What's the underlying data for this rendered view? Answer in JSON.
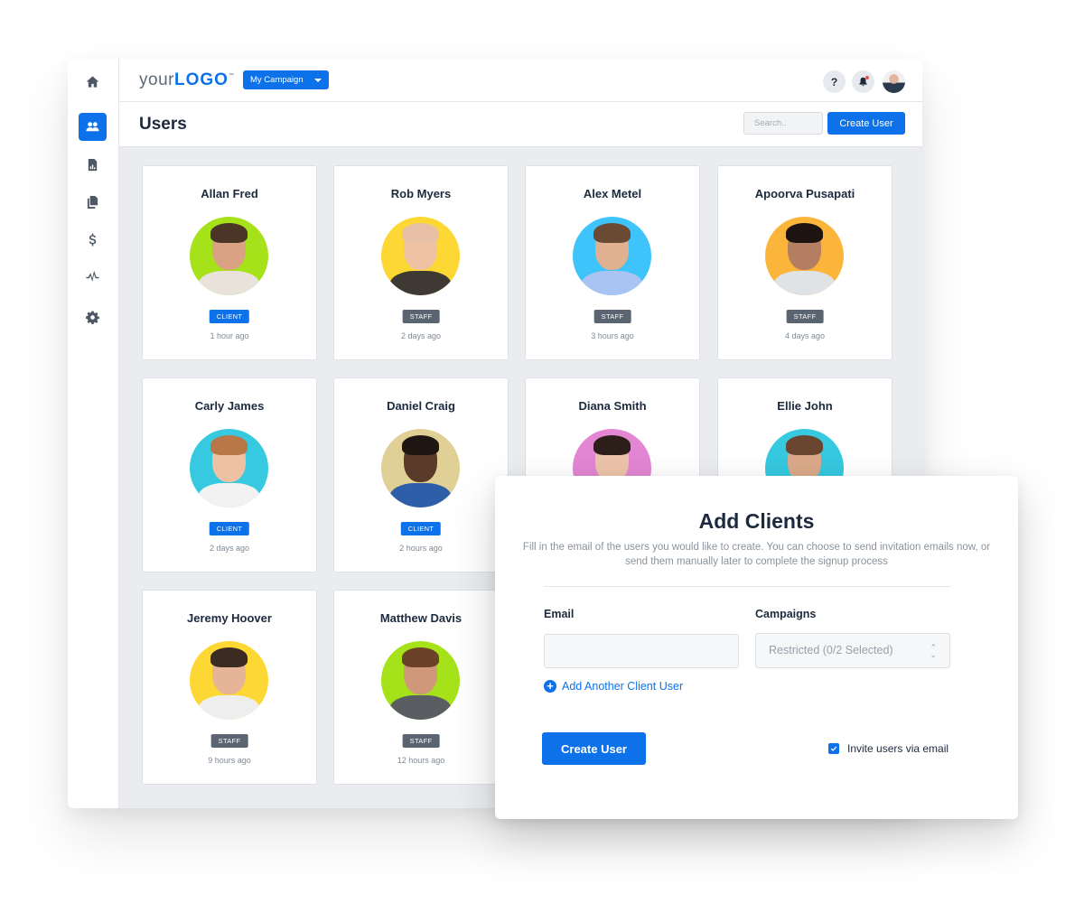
{
  "app": {
    "logo": {
      "prefix": "your",
      "brand": "LOGO",
      "tm": "™"
    },
    "campaign_selector": {
      "label": "My Campaign"
    },
    "help_label": "?",
    "accent_color": "#0d72ea"
  },
  "sidebar": {
    "items": [
      {
        "name": "home",
        "icon": "home-icon",
        "active": false
      },
      {
        "name": "users",
        "icon": "users-icon",
        "active": true
      },
      {
        "name": "reports",
        "icon": "report-chart-icon",
        "active": false
      },
      {
        "name": "documents",
        "icon": "documents-icon",
        "active": false
      },
      {
        "name": "billing",
        "icon": "dollar-icon",
        "active": false
      },
      {
        "name": "activity",
        "icon": "pulse-icon",
        "active": false
      },
      {
        "name": "settings",
        "icon": "gear-icon",
        "active": false
      }
    ]
  },
  "header": {
    "title": "Users",
    "search_placeholder": "Search..",
    "create_button": "Create User"
  },
  "users": [
    {
      "name": "Allan Fred",
      "role": "CLIENT",
      "time": "1 hour ago",
      "bg": "#a6e21a",
      "skin": "#d9a383",
      "hair": "#4a3526",
      "shirt": "#e8e2da"
    },
    {
      "name": "Rob Myers",
      "role": "STAFF",
      "time": "2 days ago",
      "bg": "#fdd835",
      "skin": "#f0c2a4",
      "hair": "#e8c0a6",
      "shirt": "#3e3a33"
    },
    {
      "name": "Alex Metel",
      "role": "STAFF",
      "time": "3 hours ago",
      "bg": "#3ec4fb",
      "skin": "#e0b090",
      "hair": "#6b4a34",
      "shirt": "#a9c3f2"
    },
    {
      "name": "Apoorva Pusapati",
      "role": "STAFF",
      "time": "4 days ago",
      "bg": "#fbb53b",
      "skin": "#b47e62",
      "hair": "#1d1412",
      "shirt": "#dfe3e6"
    },
    {
      "name": "Carly James",
      "role": "CLIENT",
      "time": "2 days ago",
      "bg": "#36c9e0",
      "skin": "#ecc1a4",
      "hair": "#b87746",
      "shirt": "#f2f2f2"
    },
    {
      "name": "Daniel Craig",
      "role": "CLIENT",
      "time": "2 hours ago",
      "bg": "#e0d095",
      "skin": "#5a3a28",
      "hair": "#1f1612",
      "shirt": "#2e5ea8"
    },
    {
      "name": "Diana Smith",
      "role": "",
      "time": "",
      "bg": "#e386d4",
      "skin": "#ecc4aa",
      "hair": "#2c1e18",
      "shirt": "#2c1e18"
    },
    {
      "name": "Ellie John",
      "role": "",
      "time": "",
      "bg": "#36c9e0",
      "skin": "#dba98a",
      "hair": "#6a4630",
      "shirt": "#6a4630"
    },
    {
      "name": "Jeremy Hoover",
      "role": "STAFF",
      "time": "9 hours ago",
      "bg": "#fdd835",
      "skin": "#e6b597",
      "hair": "#3c2b22",
      "shirt": "#eeeeee"
    },
    {
      "name": "Matthew Davis",
      "role": "STAFF",
      "time": "12 hours ago",
      "bg": "#a6e21a",
      "skin": "#cf9878",
      "hair": "#6b4228",
      "shirt": "#5a5e62"
    }
  ],
  "modal": {
    "title": "Add Clients",
    "description": "Fill in the email of the users you would like to create. You can choose to send invitation emails now, or send them manually later to complete the signup process",
    "email_label": "Email",
    "email_value": "",
    "campaigns_label": "Campaigns",
    "campaigns_value": "Restricted (0/2 Selected)",
    "add_another_label": "Add Another Client User",
    "create_button": "Create User",
    "invite_label": "Invite users via email",
    "invite_checked": true
  }
}
